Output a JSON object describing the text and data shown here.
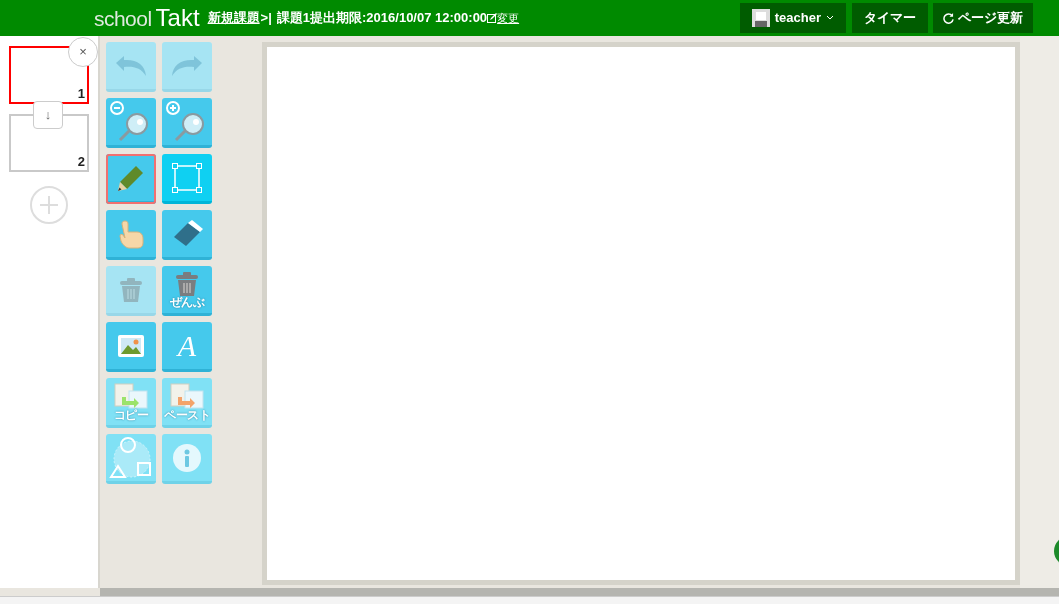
{
  "header": {
    "logo_light": "school",
    "logo_bold": "Takt",
    "task_link": "新規課題",
    "separator": ">|",
    "deadline": "課題1提出期限:2016/10/07 12:00:00",
    "change_link": "変更",
    "user": "teacher",
    "timer_button": "タイマー",
    "reload_button": "ページ更新"
  },
  "pages": [
    {
      "number": "1",
      "selected": true
    },
    {
      "number": "2",
      "selected": false
    }
  ],
  "close_button": "×",
  "move_down_button": "↓",
  "tools": [
    {
      "kind": "undo",
      "disabled": true,
      "dimmed": false,
      "selected": false
    },
    {
      "kind": "redo",
      "disabled": true,
      "dimmed": false,
      "selected": false
    },
    {
      "kind": "zoom-out",
      "disabled": false,
      "dimmed": false,
      "selected": false
    },
    {
      "kind": "zoom-in",
      "disabled": false,
      "dimmed": false,
      "selected": false
    },
    {
      "kind": "pencil",
      "disabled": false,
      "dimmed": false,
      "selected": true
    },
    {
      "kind": "select",
      "disabled": false,
      "dimmed": false,
      "selected": false
    },
    {
      "kind": "hand",
      "disabled": false,
      "dimmed": false,
      "selected": false
    },
    {
      "kind": "eraser",
      "disabled": false,
      "dimmed": false,
      "selected": false
    },
    {
      "kind": "trash",
      "disabled": true,
      "dimmed": false,
      "selected": false
    },
    {
      "kind": "trash-all",
      "disabled": false,
      "dimmed": false,
      "selected": false,
      "label": "ぜんぶ"
    },
    {
      "kind": "image",
      "disabled": false,
      "dimmed": false,
      "selected": false
    },
    {
      "kind": "text",
      "disabled": false,
      "dimmed": false,
      "selected": false,
      "label": "A"
    },
    {
      "kind": "copy",
      "disabled": false,
      "dimmed": true,
      "selected": false,
      "label": "コピー"
    },
    {
      "kind": "paste",
      "disabled": false,
      "dimmed": true,
      "selected": false,
      "label": "ペースト"
    },
    {
      "kind": "shapes",
      "disabled": false,
      "dimmed": true,
      "selected": false
    },
    {
      "kind": "info",
      "disabled": false,
      "dimmed": true,
      "selected": false
    }
  ]
}
